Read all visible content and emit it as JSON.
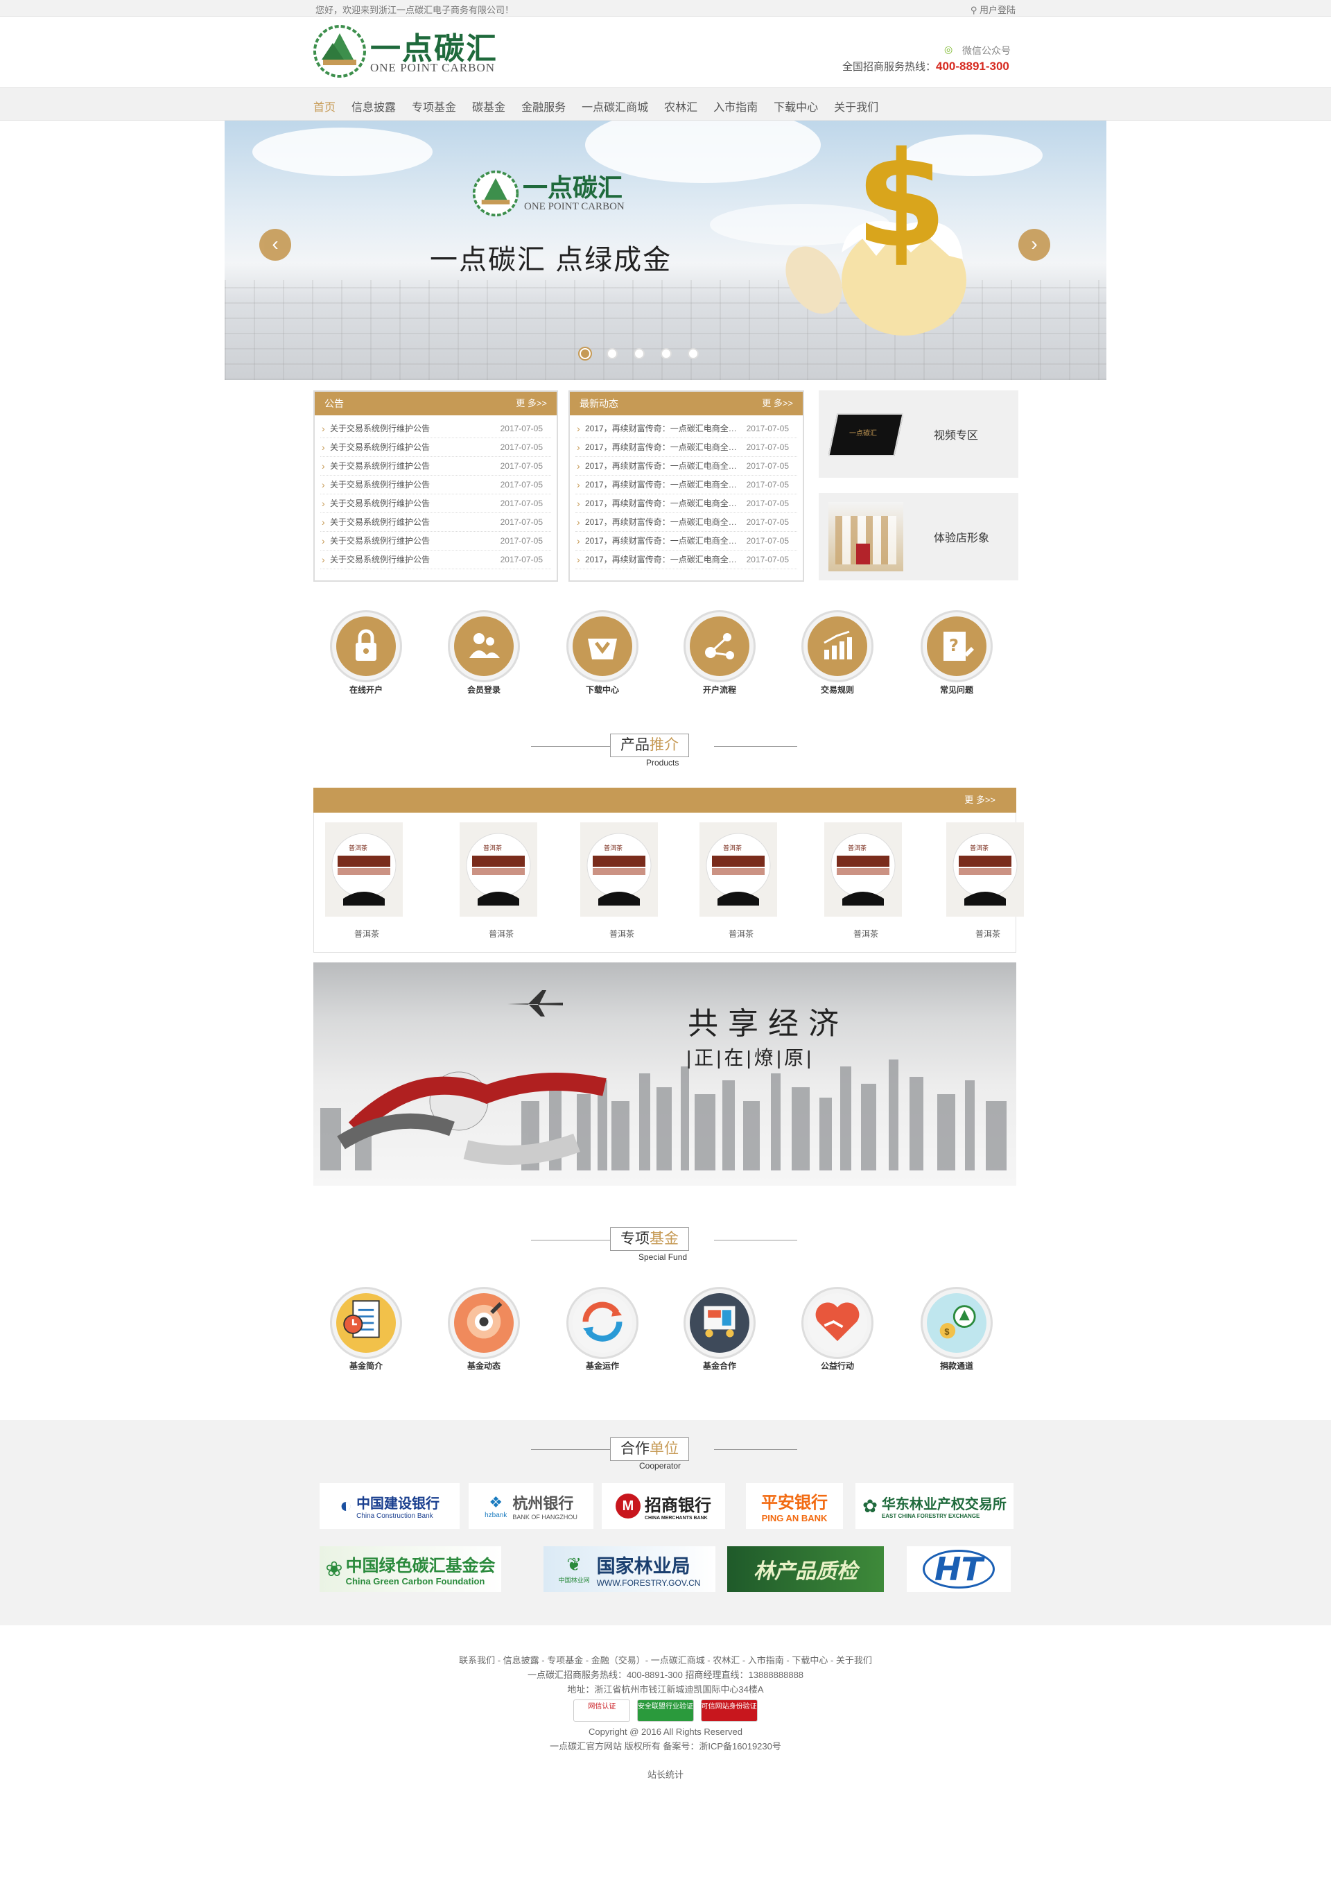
{
  "topbar": {
    "welcome": "您好，欢迎来到浙江一点碳汇电子商务有限公司！",
    "login": "用户登陆"
  },
  "header": {
    "logo_cn": "一点碳汇",
    "logo_en": "ONE POINT CARBON",
    "wechat": "微信公众号",
    "hotline_label": "全国招商服务热线：",
    "hotline": "400-8891-300"
  },
  "nav": {
    "items": [
      "首页",
      "信息披露",
      "专项基金",
      "碳基金",
      "金融服务",
      "一点碳汇商城",
      "农林汇",
      "入市指南",
      "下载中心",
      "关于我们"
    ],
    "active": "首页"
  },
  "banner": {
    "logo_cn": "一点碳汇",
    "logo_en": "ONE POINT CARBON",
    "slogan": "一点碳汇  点绿成金",
    "prev": "‹",
    "next": "›",
    "slides": 5,
    "active_slide": 1
  },
  "notice": {
    "title": "公告",
    "more": "更 多>>",
    "items": [
      {
        "text": "关于交易系统例行维护公告",
        "date": "2017-07-05"
      },
      {
        "text": "关于交易系统例行维护公告",
        "date": "2017-07-05"
      },
      {
        "text": "关于交易系统例行维护公告",
        "date": "2017-07-05"
      },
      {
        "text": "关于交易系统例行维护公告",
        "date": "2017-07-05"
      },
      {
        "text": "关于交易系统例行维护公告",
        "date": "2017-07-05"
      },
      {
        "text": "关于交易系统例行维护公告",
        "date": "2017-07-05"
      },
      {
        "text": "关于交易系统例行维护公告",
        "date": "2017-07-05"
      },
      {
        "text": "关于交易系统例行维护公告",
        "date": "2017-07-05"
      }
    ]
  },
  "news": {
    "title": "最新动态",
    "more": "更 多>>",
    "items": [
      {
        "text": "2017，再续财富传奇：一点碳汇电商全…",
        "date": "2017-07-05"
      },
      {
        "text": "2017，再续财富传奇：一点碳汇电商全…",
        "date": "2017-07-05"
      },
      {
        "text": "2017，再续财富传奇：一点碳汇电商全…",
        "date": "2017-07-05"
      },
      {
        "text": "2017，再续财富传奇：一点碳汇电商全…",
        "date": "2017-07-05"
      },
      {
        "text": "2017，再续财富传奇：一点碳汇电商全…",
        "date": "2017-07-05"
      },
      {
        "text": "2017，再续财富传奇：一点碳汇电商全…",
        "date": "2017-07-05"
      },
      {
        "text": "2017，再续财富传奇：一点碳汇电商全…",
        "date": "2017-07-05"
      },
      {
        "text": "2017，再续财富传奇：一点碳汇电商全…",
        "date": "2017-07-05"
      }
    ]
  },
  "side": {
    "video": "视频专区",
    "store": "体验店形象"
  },
  "quick": [
    "在线开户",
    "会员登录",
    "下载中心",
    "开户流程",
    "交易规则",
    "常见问题"
  ],
  "products_section": {
    "title_a": "产品",
    "title_b": "推介",
    "en": "Products",
    "more": "更 多>>",
    "items": [
      "普洱茶",
      "普洱茶",
      "普洱茶",
      "普洱茶",
      "普洱茶",
      "普洱茶"
    ],
    "label": "普洱茶"
  },
  "ad": {
    "line1": "共享经济",
    "line2": "|正|在|燎|原|"
  },
  "fund_section": {
    "title_a": "专项",
    "title_b": "基金",
    "en": "Special Fund",
    "items": [
      "基金简介",
      "基金动态",
      "基金运作",
      "基金合作",
      "公益行动",
      "捐款通道"
    ]
  },
  "partner_section": {
    "title_a": "合作",
    "title_b": "单位",
    "en": "Cooperator",
    "logos": {
      "ccb_cn": "中国建设银行",
      "ccb_en": "China Construction Bank",
      "hz_cn": "杭州银行",
      "hz_en": "BANK OF HANGZHOU",
      "hz_small": "hzbank",
      "cmb_cn": "招商银行",
      "cmb_en": "CHINA MERCHANTS BANK",
      "pa_cn": "平安银行",
      "pa_en": "PING AN BANK",
      "ecfe_cn": "华东林业产权交易所",
      "ecfe_en": "EAST CHINA FORESTRY EXCHANGE",
      "cgcf_cn": "中国绿色碳汇基金会",
      "cgcf_en": "China Green Carbon Foundation",
      "forestry_cn": "国家林业局",
      "forestry_url": "WWW.FORESTRY.GOV.CN",
      "forestry_small": "中国林业网",
      "lqgc": "林产品质检",
      "ht": "HT"
    }
  },
  "footer": {
    "links": "联系我们 - 信息披露 - 专项基金 - 金融（交易）- 一点碳汇商城 - 农林汇 - 入市指南 - 下载中心 - 关于我们",
    "phones": "一点碳汇招商服务热线：400-8891-300    招商经理直线：13888888888",
    "address": "地址：浙江省杭州市钱江新城迪凯国际中心34楼A",
    "badges": [
      "网信认证",
      "安全联盟行业验证",
      "可信网站身份验证"
    ],
    "copyright": "Copyright @ 2016 All Rights Reserved",
    "icp": "一点碳汇官方网站 版权所有 备案号：浙ICP备16019230号",
    "stats": "站长统计"
  },
  "colors": {
    "accent": "#c69a55",
    "brand_green": "#1f6a3c",
    "hotline_red": "#d62a20"
  }
}
